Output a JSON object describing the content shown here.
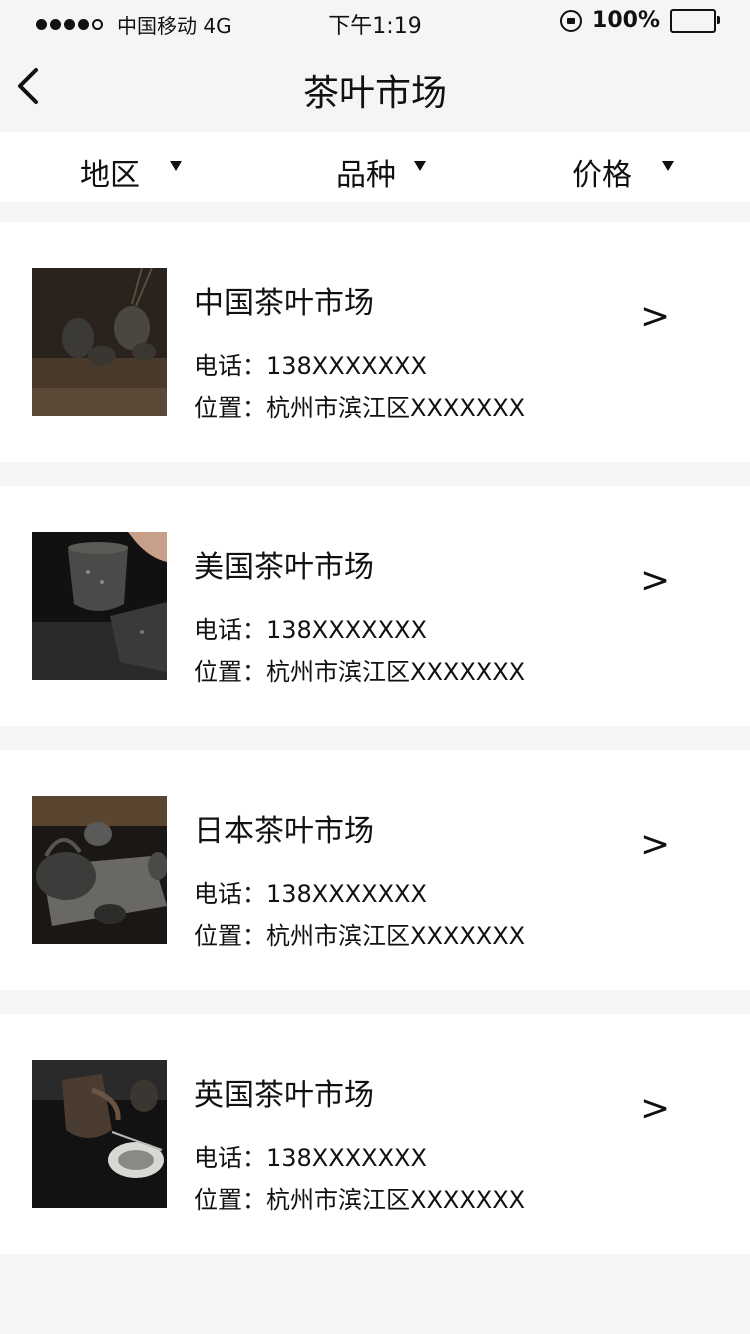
{
  "status_bar": {
    "carrier": "中国移动 4G",
    "time": "下午1:19",
    "battery": "100%"
  },
  "nav": {
    "title": "茶叶市场"
  },
  "filters": [
    {
      "label": "地区"
    },
    {
      "label": "品种"
    },
    {
      "label": "价格"
    }
  ],
  "markets": [
    {
      "name": "中国茶叶市场",
      "phone": "电话：138XXXXXXX",
      "address": "位置：杭州市滨江区XXXXXXX",
      "arrow": ">"
    },
    {
      "name": "美国茶叶市场",
      "phone": "电话：138XXXXXXX",
      "address": "位置：杭州市滨江区XXXXXXX",
      "arrow": ">"
    },
    {
      "name": "日本茶叶市场",
      "phone": "电话：138XXXXXXX",
      "address": "位置：杭州市滨江区XXXXXXX",
      "arrow": ">"
    },
    {
      "name": "英国茶叶市场",
      "phone": "电话：138XXXXXXX",
      "address": "位置：杭州市滨江区XXXXXXX",
      "arrow": ">"
    }
  ],
  "colors": {
    "page_background": "#f5f5f5",
    "card_background": "#ffffff",
    "text": "#111111"
  }
}
